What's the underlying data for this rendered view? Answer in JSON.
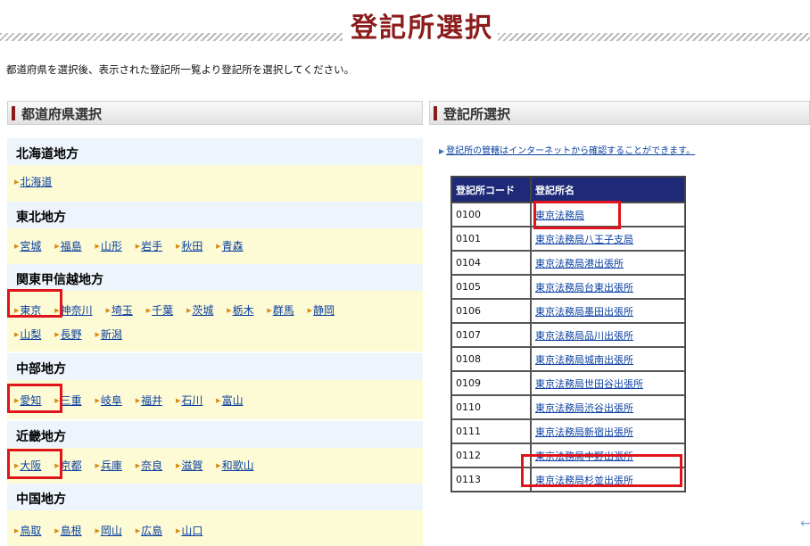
{
  "page": {
    "title": "登記所選択",
    "instruction": "都道府県を選択後、表示された登記所一覧より登記所を選択してください。"
  },
  "prefecture_section": {
    "header": "都道府県選択",
    "regions": [
      {
        "name": "北海道地方",
        "rows": [
          [
            "北海道"
          ]
        ]
      },
      {
        "name": "東北地方",
        "rows": [
          [
            "宮城",
            "福島",
            "山形",
            "岩手",
            "秋田",
            "青森"
          ]
        ]
      },
      {
        "name": "関東甲信越地方",
        "rows": [
          [
            "東京",
            "神奈川",
            "埼玉",
            "千葉",
            "茨城",
            "栃木",
            "群馬",
            "静岡"
          ],
          [
            "山梨",
            "長野",
            "新潟"
          ]
        ]
      },
      {
        "name": "中部地方",
        "rows": [
          [
            "愛知",
            "三重",
            "岐阜",
            "福井",
            "石川",
            "富山"
          ]
        ]
      },
      {
        "name": "近畿地方",
        "rows": [
          [
            "大阪",
            "京都",
            "兵庫",
            "奈良",
            "滋賀",
            "和歌山"
          ]
        ]
      },
      {
        "name": "中国地方",
        "rows": [
          [
            "鳥取",
            "島根",
            "岡山",
            "広島",
            "山口"
          ]
        ]
      }
    ]
  },
  "registry_section": {
    "header": "登記所選択",
    "note": "登記所の管轄はインターネットから確認することができます。",
    "table": {
      "headers": [
        "登記所コード",
        "登記所名"
      ],
      "rows": [
        [
          "0100",
          "東京法務局"
        ],
        [
          "0101",
          "東京法務局八王子支局"
        ],
        [
          "0104",
          "東京法務局港出張所"
        ],
        [
          "0105",
          "東京法務局台東出張所"
        ],
        [
          "0106",
          "東京法務局墨田出張所"
        ],
        [
          "0107",
          "東京法務局品川出張所"
        ],
        [
          "0108",
          "東京法務局城南出張所"
        ],
        [
          "0109",
          "東京法務局世田谷出張所"
        ],
        [
          "0110",
          "東京法務局渋谷出張所"
        ],
        [
          "0111",
          "東京法務局新宿出張所"
        ],
        [
          "0112",
          "東京法務局中野出張所"
        ],
        [
          "0113",
          "東京法務局杉並出張所"
        ]
      ]
    }
  },
  "colors": {
    "title": "#8c1c1c",
    "table_header_bg": "#1e2a78",
    "link": "#0a3fa0",
    "highlight": "#e0141b",
    "region_head_bg": "#edf4fb",
    "region_body_bg": "#fdfbd5"
  },
  "icons": {
    "link_marker": "triangle-right-icon",
    "back": "arrow-left-icon"
  }
}
